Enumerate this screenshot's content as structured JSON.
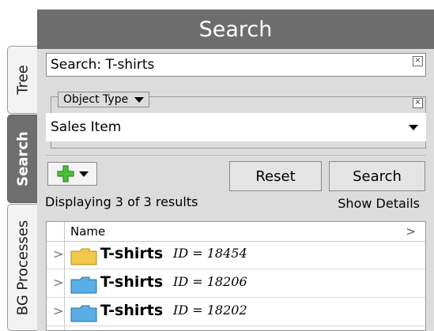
{
  "tabs": [
    {
      "label": "Tree",
      "active": false
    },
    {
      "label": "Search",
      "active": true
    },
    {
      "label": "BG Processes",
      "active": false
    }
  ],
  "panel": {
    "title": "Search",
    "search_value": "Search: T-shirts",
    "clear_icon": "close-x-icon",
    "filter": {
      "label": "Object Type",
      "selected": "Sales Item"
    },
    "buttons": {
      "add_icon": "green-plus-icon",
      "reset": "Reset",
      "search": "Search"
    },
    "status": "Displaying 3 of 3 results",
    "show_details": "Show Details",
    "grid": {
      "column": "Name",
      "rows": [
        {
          "name": "T-shirts",
          "id_text": "ID = 18454",
          "folder_color": "#f2c94c"
        },
        {
          "name": "T-shirts",
          "id_text": "ID = 18206",
          "folder_color": "#5aaee6"
        },
        {
          "name": "T-shirts",
          "id_text": "ID = 18202",
          "folder_color": "#5aaee6"
        }
      ]
    }
  },
  "colors": {
    "header_bg": "#6d6d6d",
    "panel_bg": "#dcdcdc",
    "active_tab_bg": "#6e6e6e"
  }
}
